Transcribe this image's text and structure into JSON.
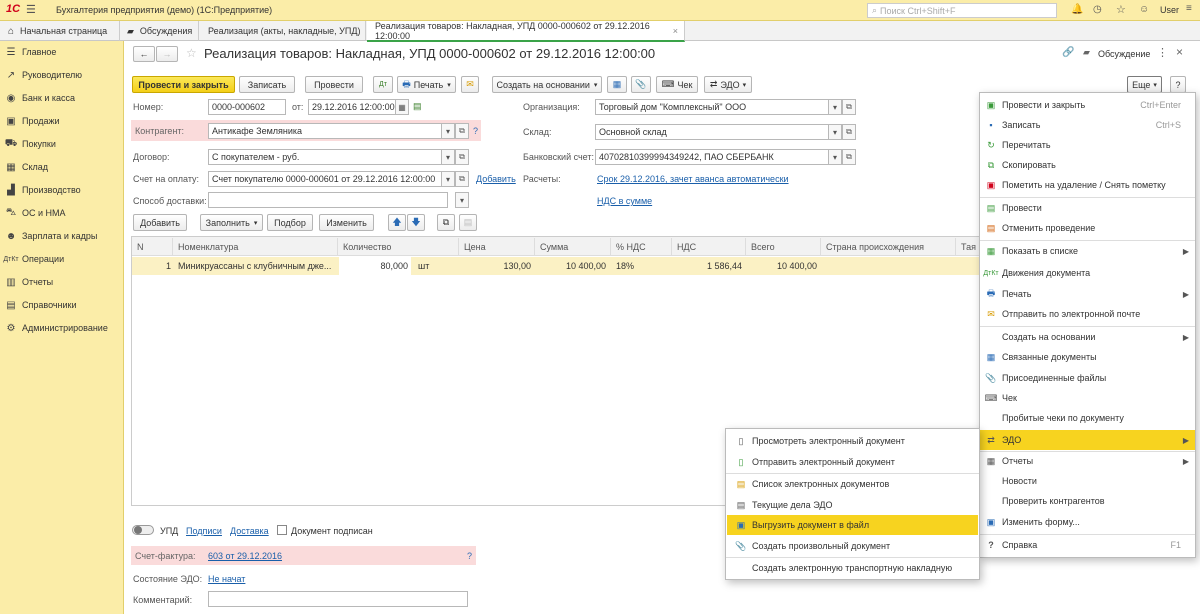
{
  "app": {
    "logo": "1С",
    "title": "Бухгалтерия предприятия (демо)  (1С:Предприятие)",
    "search_placeholder": "Поиск Ctrl+Shift+F",
    "user": "User"
  },
  "tabs": [
    {
      "label": "Начальная страница"
    },
    {
      "label": "Обсуждения"
    },
    {
      "label": "Реализация (акты, накладные, УПД)"
    },
    {
      "label": "Реализация товаров: Накладная, УПД 0000-000602 от 29.12.2016 12:00:00"
    }
  ],
  "sidebar": {
    "items": [
      {
        "label": "Главное"
      },
      {
        "label": "Руководителю"
      },
      {
        "label": "Банк и касса"
      },
      {
        "label": "Продажи"
      },
      {
        "label": "Покупки"
      },
      {
        "label": "Склад"
      },
      {
        "label": "Производство"
      },
      {
        "label": "ОС и НМА"
      },
      {
        "label": "Зарплата и кадры"
      },
      {
        "label": "Операции"
      },
      {
        "label": "Отчеты"
      },
      {
        "label": "Справочники"
      },
      {
        "label": "Администрирование"
      }
    ]
  },
  "doc": {
    "title": "Реализация товаров: Накладная, УПД 0000-000602 от 29.12.2016 12:00:00",
    "discussion": "Обсуждение"
  },
  "toolbar": {
    "post_close": "Провести и закрыть",
    "save": "Записать",
    "post": "Провести",
    "print": "Печать",
    "create_based": "Создать на основании",
    "check": "Чек",
    "edo": "ЭДО",
    "more": "Еще",
    "help": "?"
  },
  "form": {
    "number_label": "Номер:",
    "number": "0000-000602",
    "date_label": "от:",
    "date": "29.12.2016 12:00:00",
    "org_label": "Организация:",
    "org": "Торговый дом \"Комплексный\" ООО",
    "contractor_label": "Контрагент:",
    "contractor": "Антикафе Земляника",
    "warehouse_label": "Склад:",
    "warehouse": "Основной склад",
    "contract_label": "Договор:",
    "contract": "С покупателем - руб.",
    "bank_label": "Банковский счет:",
    "bank": "40702810399994349242, ПАО СБЕРБАНК",
    "invoice_label": "Счет на оплату:",
    "invoice": "Счет покупателю 0000-000601 от 29.12.2016 12:00:00",
    "add": "Добавить",
    "settlements_label": "Расчеты:",
    "settlements": "Срок 29.12.2016, зачет аванса автоматически",
    "delivery_label": "Способ доставки:",
    "vat": "НДС в сумме"
  },
  "table_toolbar": {
    "add": "Добавить",
    "fill": "Заполнить",
    "select": "Подбор",
    "change": "Изменить"
  },
  "table": {
    "headers": [
      "N",
      "Номенклатура",
      "Количество",
      "",
      "Цена",
      "Сумма",
      "% НДС",
      "НДС",
      "Всего",
      "Страна происхождения",
      "Тая"
    ],
    "rows": [
      [
        "1",
        "Миникруассаны с клубничным дже...",
        "80,000",
        "шт",
        "130,00",
        "10 400,00",
        "18%",
        "1 586,44",
        "10 400,00",
        ""
      ]
    ]
  },
  "footer": {
    "upd": "УПД",
    "signatures": "Подписи",
    "delivery": "Доставка",
    "signed": "Документ подписан",
    "invoice_label": "Счет-фактура:",
    "invoice": "603 от 29.12.2016",
    "help": "?",
    "edo_state_label": "Состояние ЭДО:",
    "edo_state": "Не начат",
    "comment_label": "Комментарий:"
  },
  "more_menu": [
    {
      "label": "Провести и закрыть",
      "shortcut": "Ctrl+Enter",
      "icon": "check-doc-icon"
    },
    {
      "label": "Записать",
      "shortcut": "Ctrl+S",
      "icon": "save-icon"
    },
    {
      "label": "Перечитать",
      "shortcut": "",
      "icon": "refresh-icon"
    },
    {
      "label": "Скопировать",
      "shortcut": "",
      "icon": "copy-icon"
    },
    {
      "label": "Пометить на удаление / Снять пометку",
      "shortcut": "",
      "icon": "delete-mark-icon"
    },
    {
      "label": "Провести",
      "shortcut": "",
      "icon": "post-icon"
    },
    {
      "label": "Отменить проведение",
      "shortcut": "",
      "icon": "unpost-icon"
    },
    {
      "label": "Показать в списке",
      "shortcut": "",
      "icon": "list-icon"
    },
    {
      "label": "Движения документа",
      "shortcut": "",
      "icon": "movements-icon"
    },
    {
      "label": "Печать",
      "shortcut": "",
      "icon": "print-icon"
    },
    {
      "label": "Отправить по электронной почте",
      "shortcut": "",
      "icon": "mail-icon"
    },
    {
      "label": "Создать на основании",
      "shortcut": "",
      "icon": ""
    },
    {
      "label": "Связанные документы",
      "shortcut": "",
      "icon": "related-icon"
    },
    {
      "label": "Присоединенные файлы",
      "shortcut": "",
      "icon": "paperclip-icon"
    },
    {
      "label": "Чек",
      "shortcut": "",
      "icon": "receipt-icon"
    },
    {
      "label": "Пробитые чеки по документу",
      "shortcut": "",
      "icon": ""
    },
    {
      "label": "ЭДО",
      "shortcut": "",
      "icon": "edo-icon"
    },
    {
      "label": "Отчеты",
      "shortcut": "",
      "icon": "reports-icon"
    },
    {
      "label": "Новости",
      "shortcut": "",
      "icon": ""
    },
    {
      "label": "Проверить контрагентов",
      "shortcut": "",
      "icon": ""
    },
    {
      "label": "Изменить форму...",
      "shortcut": "",
      "icon": "form-icon"
    },
    {
      "label": "Справка",
      "shortcut": "F1",
      "icon": "help-icon"
    }
  ],
  "edo_menu": [
    {
      "label": "Просмотреть электронный документ"
    },
    {
      "label": "Отправить электронный документ"
    },
    {
      "label": "Список электронных документов"
    },
    {
      "label": "Текущие дела ЭДО"
    },
    {
      "label": "Выгрузить документ в файл"
    },
    {
      "label": "Создать произвольный документ"
    },
    {
      "label": "Создать электронную транспортную накладную"
    }
  ]
}
